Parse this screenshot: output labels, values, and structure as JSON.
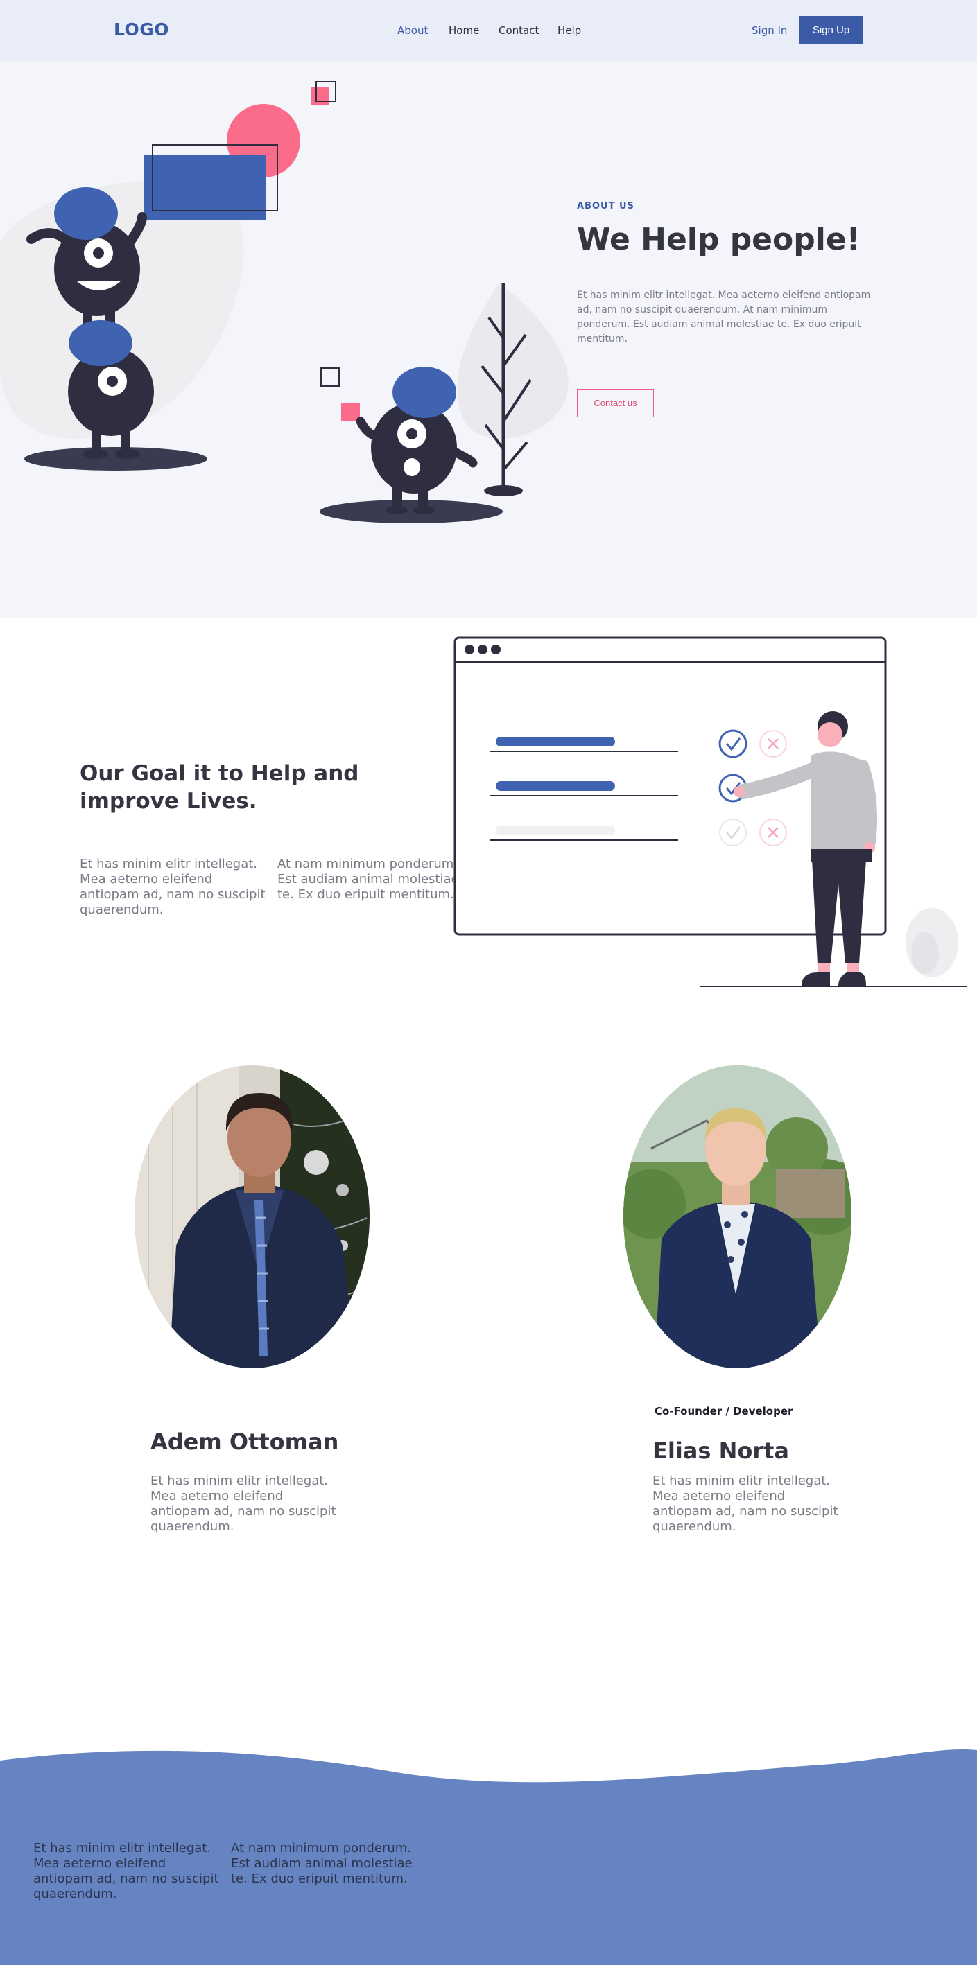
{
  "nav": {
    "logo": "LOGO",
    "links": [
      {
        "label": "About",
        "active": true
      },
      {
        "label": "Home",
        "active": false
      },
      {
        "label": "Contact",
        "active": false
      },
      {
        "label": "Help",
        "active": false
      }
    ],
    "sign_in": "Sign In",
    "sign_up": "Sign Up"
  },
  "hero": {
    "eyebrow": "ABOUT US",
    "title": "We Help people!",
    "text": "Et has minim elitr intellegat. Mea aeterno eleifend antiopam ad, nam no suscipit quaerendum. At nam minimum ponderum. Est audiam animal molestiae te. Ex duo eripuit mentitum.",
    "cta": "Contact us"
  },
  "goal": {
    "title": "Our Goal it to Help and improve Lives.",
    "col1": "Et has minim elitr intellegat. Mea aeterno eleifend antiopam ad, nam no suscipit quaerendum.",
    "col2": "At nam minimum ponderum. Est audiam animal molestiae te. Ex duo eripuit mentitum."
  },
  "team": [
    {
      "name": "Adem Ottoman",
      "role": "",
      "bio": "Et has minim elitr intellegat. Mea aeterno eleifend antiopam ad, nam no suscipit quaerendum."
    },
    {
      "name": "Elias Norta",
      "role": "Co-Founder / Developer",
      "bio": "Et has minim elitr intellegat. Mea aeterno eleifend antiopam ad, nam no suscipit quaerendum."
    }
  ],
  "footer": {
    "col1": "Et has minim elitr intellegat. Mea aeterno eleifend antiopam ad, nam no suscipit quaerendum.",
    "col2": "At nam minimum ponderum. Est audiam animal molestiae te. Ex duo eripuit mentitum."
  },
  "colors": {
    "primary": "#3b5ba6",
    "accent_pink": "#f35b82",
    "dark": "#2f2e41",
    "hero_bg": "#f4f5fa",
    "footer_bg": "#6584c1"
  }
}
